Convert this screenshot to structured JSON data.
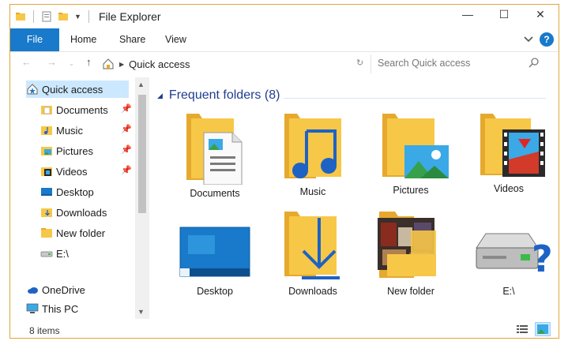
{
  "window": {
    "title": "File Explorer",
    "controls": [
      "—",
      "☐",
      "✕"
    ]
  },
  "ribbon": {
    "file_tab": "File",
    "tabs": [
      "Home",
      "Share",
      "View"
    ],
    "collapse_icon": "chevron-down-icon",
    "help_label": "?"
  },
  "address": {
    "location": "Quick access",
    "search_placeholder": "Search Quick access"
  },
  "nav": {
    "quick_access": "Quick access",
    "pinned": [
      "Documents",
      "Music",
      "Pictures",
      "Videos"
    ],
    "items": [
      "Desktop",
      "Downloads",
      "New folder",
      "E:\\"
    ],
    "onedrive": "OneDrive",
    "this_pc": "This PC"
  },
  "content": {
    "group_title": "Frequent folders (8)",
    "tiles": [
      "Documents",
      "Music",
      "Pictures",
      "Videos",
      "Desktop",
      "Downloads",
      "New folder",
      "E:\\"
    ]
  },
  "status": {
    "count": "8 items"
  },
  "colors": {
    "accent": "#1979ca",
    "folder": "#f7c748",
    "folder_dark": "#e6a92e",
    "selection": "#cce8ff",
    "group_title": "#1f3d8f"
  }
}
